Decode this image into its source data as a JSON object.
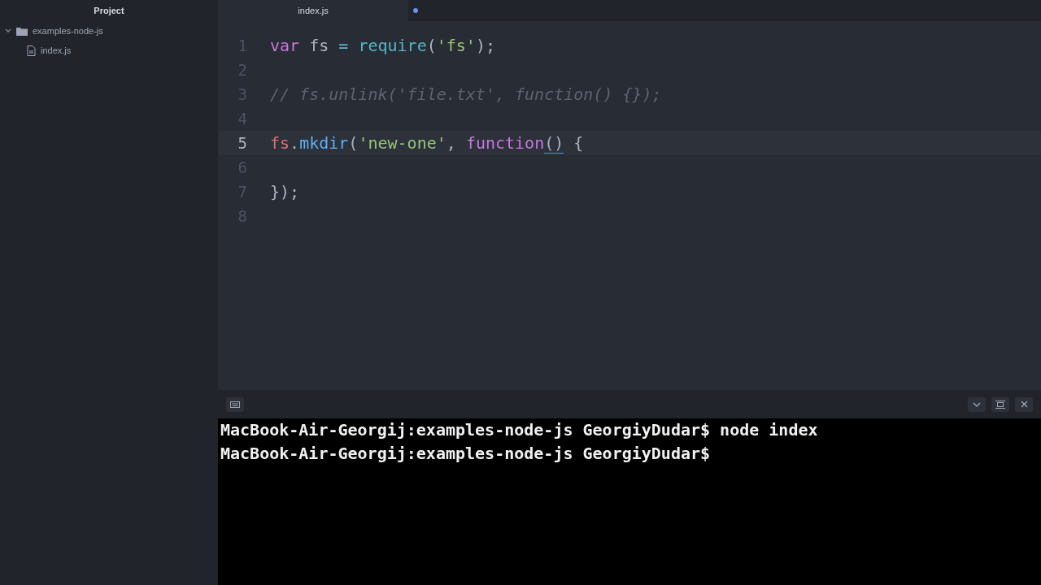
{
  "sidebar": {
    "title": "Project",
    "tree": [
      {
        "label": "examples-node-js",
        "kind": "folder",
        "expanded": true,
        "children": [
          {
            "label": "index.js",
            "kind": "file"
          }
        ]
      }
    ]
  },
  "tabs": [
    {
      "label": "index.js",
      "selected": true,
      "modified": true
    }
  ],
  "editor": {
    "lines": [
      {
        "number": "1",
        "current": false,
        "tokens": [
          {
            "text": "var",
            "kind": "keyword"
          },
          {
            "text": " fs ",
            "kind": "plain"
          },
          {
            "text": "=",
            "kind": "operator"
          },
          {
            "text": " require",
            "kind": "builtin"
          },
          {
            "text": "(",
            "kind": "plain"
          },
          {
            "text": "'fs'",
            "kind": "string"
          },
          {
            "text": ");",
            "kind": "plain"
          }
        ]
      },
      {
        "number": "2",
        "current": false
      },
      {
        "number": "3",
        "current": false,
        "tokens": [
          {
            "text": "// fs.unlink('file.txt', function() {});",
            "kind": "comment"
          }
        ]
      },
      {
        "number": "4",
        "current": false
      },
      {
        "number": "5",
        "current": true,
        "tokens": [
          {
            "text": "fs",
            "kind": "variable"
          },
          {
            "text": ".",
            "kind": "plain"
          },
          {
            "text": "mkdir",
            "kind": "function"
          },
          {
            "text": "(",
            "kind": "plain"
          },
          {
            "text": "'new-one'",
            "kind": "string"
          },
          {
            "text": ", ",
            "kind": "plain"
          },
          {
            "text": "function",
            "kind": "keyword"
          },
          {
            "text": "()",
            "kind": "matched"
          },
          {
            "text": " {",
            "kind": "plain"
          }
        ]
      },
      {
        "number": "6",
        "current": false
      },
      {
        "number": "7",
        "current": false,
        "tokens": [
          {
            "text": "});",
            "kind": "plain"
          }
        ]
      },
      {
        "number": "8",
        "current": false
      }
    ]
  },
  "terminal": {
    "lines": [
      "MacBook-Air-Georgij:examples-node-js GeorgiyDudar$ node index",
      "MacBook-Air-Georgij:examples-node-js GeorgiyDudar$"
    ]
  }
}
